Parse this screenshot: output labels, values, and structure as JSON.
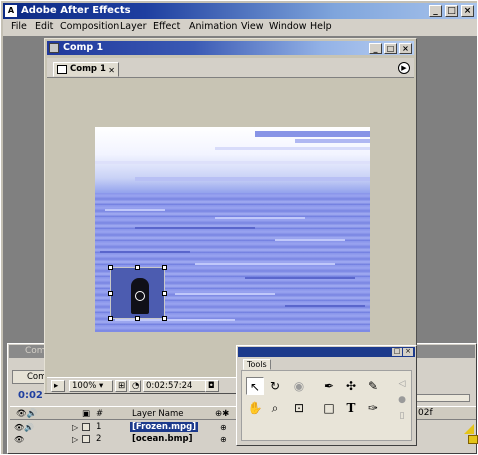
{
  "app": {
    "title": "Adobe After Effects",
    "logo_text": "A",
    "window_buttons": [
      "_",
      "□",
      "×"
    ]
  },
  "menu": [
    "File",
    "Edit",
    "Composition",
    "Layer",
    "Effect",
    "Animation",
    "View",
    "Window",
    "Help"
  ],
  "comp_window": {
    "title": "Comp 1",
    "tab_label": "Comp 1",
    "buttons": [
      "_",
      "□",
      "×"
    ],
    "zoom": "100%",
    "timecode": "0:02:57:24"
  },
  "tools": {
    "tab_label": "Tools",
    "buttons": [
      "□",
      "×"
    ],
    "icons": [
      "selection-tool-icon",
      "rotation-tool-icon",
      "orbit-camera-icon",
      "pen-tool-icon",
      "anchor-point-tool-icon",
      "brush-tool-icon",
      "hand-tool-icon",
      "zoom-tool-icon",
      "track-xy-camera-icon",
      "rectangle-mask-icon",
      "text-tool-icon",
      "pen-mask-icon"
    ]
  },
  "timeline": {
    "title": "Comp 1",
    "tab_label": "Comp",
    "timecode": "0:02",
    "columns": [
      "#",
      "Layer Name"
    ],
    "layers": [
      {
        "num": "1",
        "name": "[Frozen.mpg]",
        "selected": true
      },
      {
        "num": "2",
        "name": "[ocean.bmp]",
        "selected": false
      }
    ],
    "ruler_label": "02f"
  }
}
